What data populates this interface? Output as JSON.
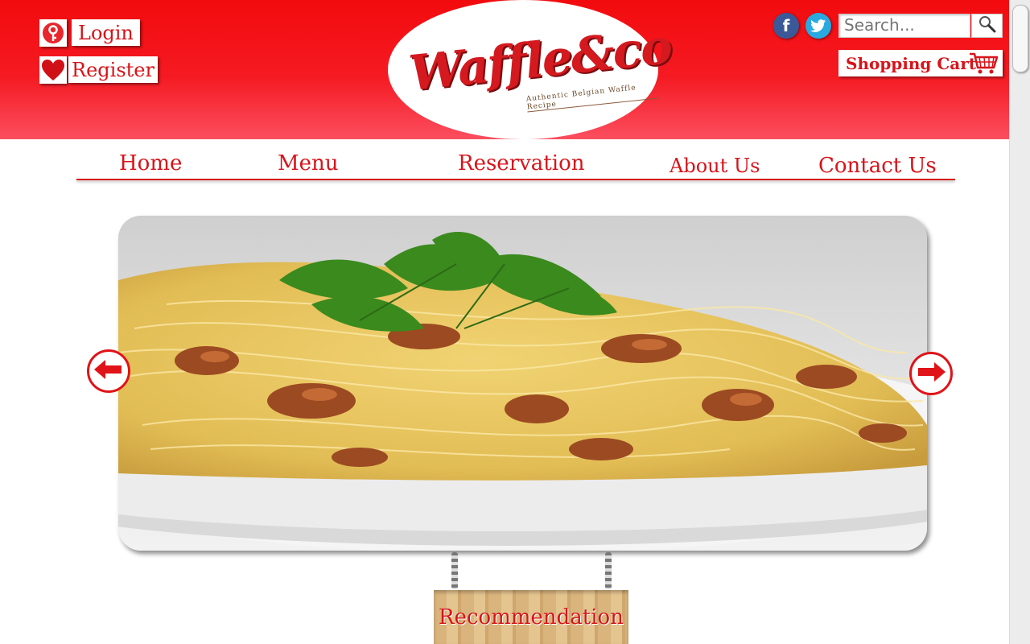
{
  "header": {
    "login_label": "Login",
    "register_label": "Register",
    "logo": {
      "name": "Waffle&co",
      "tagline": "Authentic Belgian Waffle Recipe"
    },
    "search": {
      "placeholder": "Search..."
    },
    "cart_label": "Shopping Cart"
  },
  "nav": {
    "items": [
      {
        "label": "Home"
      },
      {
        "label": "Menu"
      },
      {
        "label": "Reservation"
      },
      {
        "label": "About Us"
      },
      {
        "label": "Contact Us"
      }
    ]
  },
  "slider": {
    "image": "spaghetti-carbonara-plate"
  },
  "sign": {
    "label": "Recommendation"
  },
  "colors": {
    "brand_red": "#d7141a",
    "header_top": "#f20b0e",
    "header_bottom": "#fb4e5f"
  }
}
